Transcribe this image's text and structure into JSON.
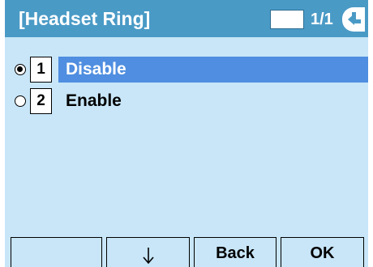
{
  "header": {
    "title": "[Headset Ring]",
    "page_indicator": "1/1",
    "back_icon": "left-arrow-icon"
  },
  "menu": {
    "items": [
      {
        "radio_selected": true,
        "number": "1",
        "label": "Disable",
        "highlighted": true
      },
      {
        "radio_selected": false,
        "number": "2",
        "label": "Enable",
        "highlighted": false
      }
    ]
  },
  "softkeys": [
    {
      "label": ""
    },
    {
      "label": "",
      "icon": "down-arrow-icon"
    },
    {
      "label": "Back"
    },
    {
      "label": "OK"
    }
  ],
  "colors": {
    "screen_background": "#c8e6f8",
    "header_background": "#4a9ac6",
    "highlight": "#4f8ee0"
  }
}
